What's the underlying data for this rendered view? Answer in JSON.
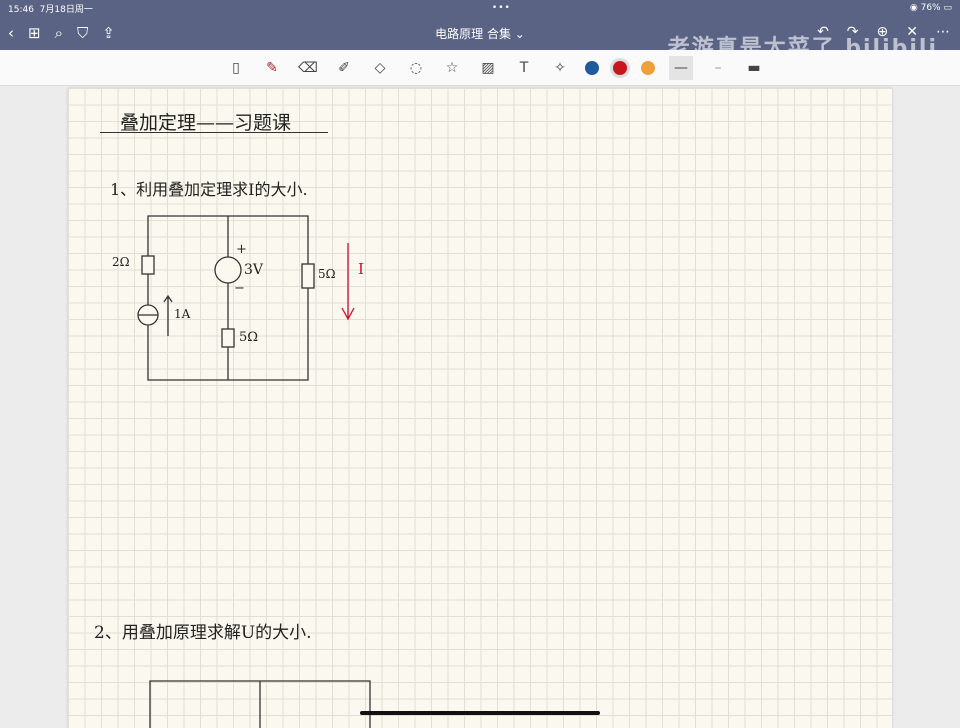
{
  "status": {
    "time": "15:46",
    "date": "7月18日周一",
    "battery": "76%"
  },
  "nav": {
    "title": "电路原理 合集",
    "watermark": "老游真是太菜了 bilibili"
  },
  "colors": {
    "blue": "#1f5a9e",
    "red": "#c8161d",
    "orange": "#f0a03a",
    "ink": "#222222",
    "accent_red": "#c8102e"
  },
  "note": {
    "heading": "叠加定理——习题课",
    "q1": "1、利用叠加定理求I的大小.",
    "q1_labels": {
      "r1": "2Ω",
      "is": "1A",
      "vs_plus": "+",
      "vs": "3V",
      "vs_minus": "−",
      "r2": "5Ω",
      "r3": "5Ω",
      "current": "I"
    },
    "q2": "2、用叠加原理求解U的大小."
  }
}
